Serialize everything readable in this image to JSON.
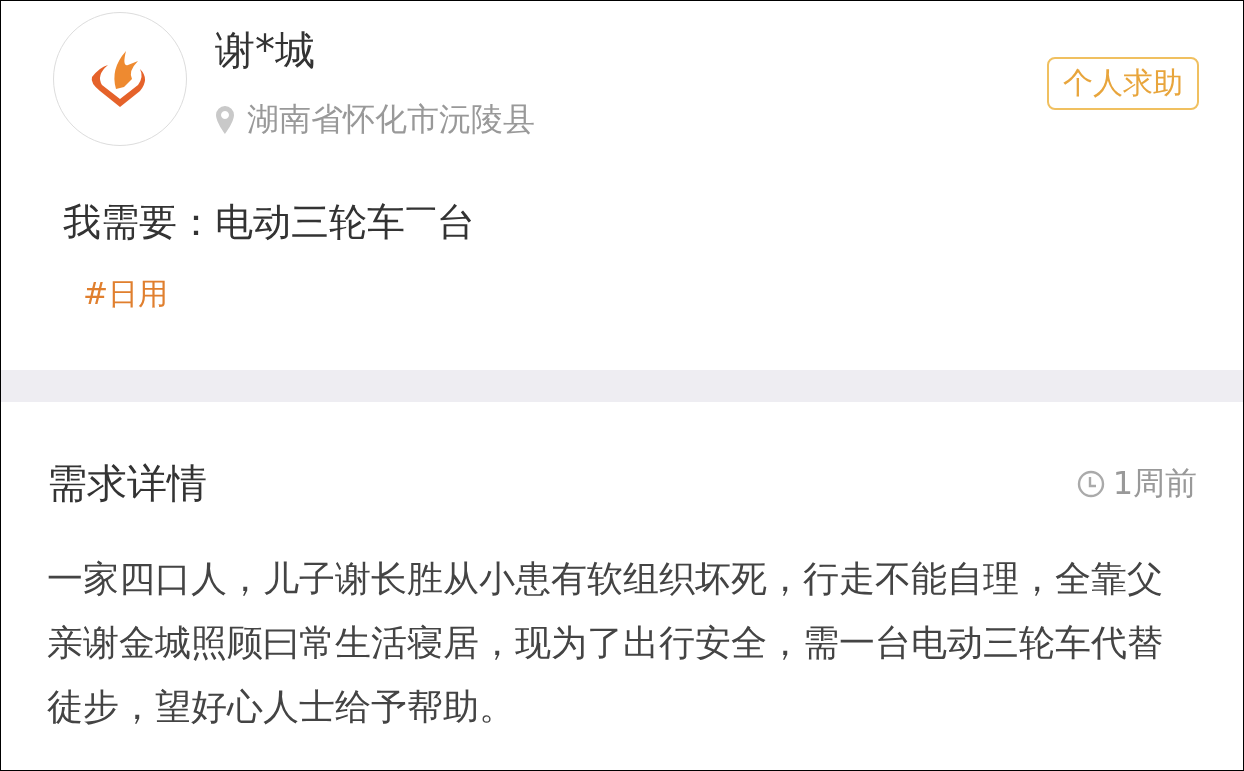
{
  "user": {
    "name": "谢*城",
    "location": "湖南省怀化市沅陵县",
    "badge": "个人求助"
  },
  "need": {
    "text": "我需要：电动三轮车$^{一}$台",
    "tag": "#日用"
  },
  "detail": {
    "title": "需求详情",
    "time": "1周前",
    "body": "一家四口人，儿子谢长胜从小患有软组织坏死，行走不能自理，全靠父亲谢金城照顾曰常生活寝居，现为了出行安全，需一台电动三轮车代替徒步，望好心人士给予帮助。"
  }
}
